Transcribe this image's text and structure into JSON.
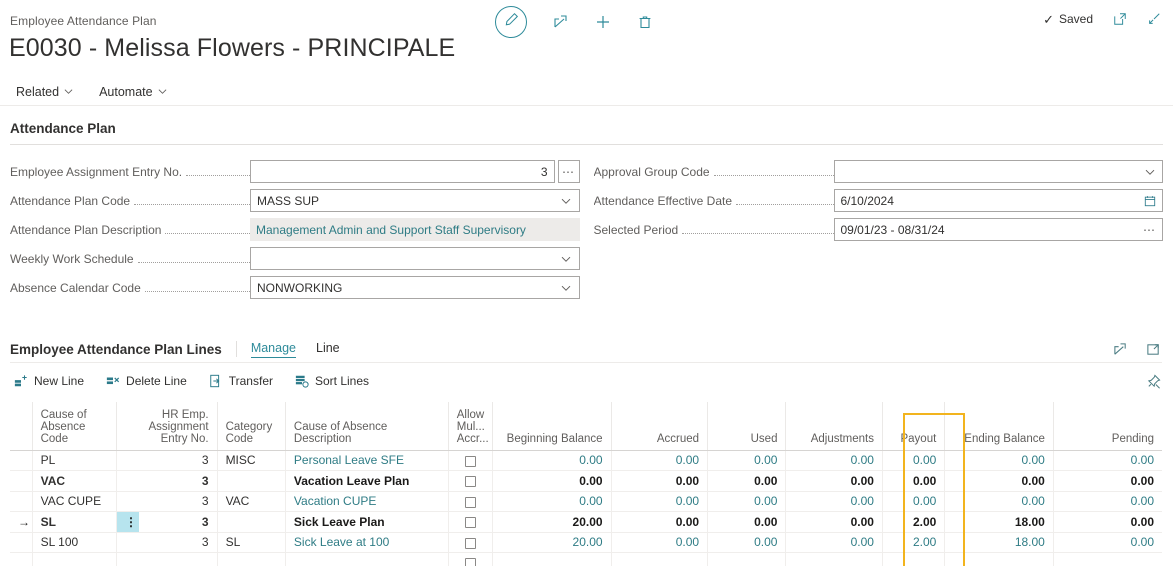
{
  "header": {
    "breadcrumb": "Employee Attendance Plan",
    "title": "E0030 - Melissa Flowers - PRINCIPALE",
    "saved_label": "Saved",
    "edit_icon": "pencil-icon",
    "share_icon": "share-icon",
    "new_icon": "plus-icon",
    "delete_icon": "trash-icon",
    "open_new_window_icon": "open-in-new-window-icon",
    "collapse_icon": "collapse-icon"
  },
  "menubar": {
    "items": [
      {
        "label": "Related",
        "icon": "chevron-down-icon"
      },
      {
        "label": "Automate",
        "icon": "chevron-down-icon"
      }
    ]
  },
  "fasttab": {
    "title": "Attendance Plan"
  },
  "form": {
    "left": [
      {
        "label": "Employee Assignment Entry No.",
        "value": "3",
        "align": "right",
        "type": "lookup",
        "icon": "ellipsis-button"
      },
      {
        "label": "Attendance Plan Code",
        "value": "MASS SUP",
        "align": "left",
        "type": "dropdown",
        "icon": "chevron-down-icon"
      },
      {
        "label": "Attendance Plan Description",
        "value": "Management Admin and Support Staff Supervisory",
        "align": "left",
        "type": "readonly",
        "icon": ""
      },
      {
        "label": "Weekly Work Schedule",
        "value": "",
        "align": "left",
        "type": "dropdown",
        "icon": "chevron-down-icon"
      },
      {
        "label": "Absence Calendar Code",
        "value": "NONWORKING",
        "align": "left",
        "type": "dropdown",
        "icon": "chevron-down-icon"
      }
    ],
    "right": [
      {
        "label": "Approval Group Code",
        "value": "",
        "align": "left",
        "type": "dropdown",
        "icon": "chevron-down-icon"
      },
      {
        "label": "Attendance Effective Date",
        "value": "6/10/2024",
        "align": "left",
        "type": "date",
        "icon": "calendar-icon"
      },
      {
        "label": "Selected Period",
        "value": "09/01/23 - 08/31/24",
        "align": "left",
        "type": "assist",
        "icon": "ellipsis-icon"
      }
    ]
  },
  "lines": {
    "title": "Employee Attendance Plan Lines",
    "tabs": [
      {
        "label": "Manage",
        "active": true
      },
      {
        "label": "Line",
        "active": false
      }
    ],
    "head_icons": [
      "share-icon",
      "expand-icon"
    ],
    "toolbar": [
      {
        "label": "New Line",
        "icon": "new-line-icon"
      },
      {
        "label": "Delete Line",
        "icon": "delete-line-icon"
      },
      {
        "label": "Transfer",
        "icon": "transfer-icon"
      },
      {
        "label": "Sort Lines",
        "icon": "sort-lines-icon"
      }
    ],
    "toolbar_right_icon": "unpin-icon",
    "columns": [
      {
        "key": "indicator",
        "label": "",
        "align": "c"
      },
      {
        "key": "cause_code",
        "label": "Cause of\nAbsence Code",
        "align": "l"
      },
      {
        "key": "menu",
        "label": "",
        "align": "c"
      },
      {
        "key": "entry_no",
        "label": "HR Emp.\nAssignment\nEntry No.",
        "align": "r"
      },
      {
        "key": "category",
        "label": "Category Code",
        "align": "l"
      },
      {
        "key": "description",
        "label": "Cause of Absence Description",
        "align": "l"
      },
      {
        "key": "allow_multi",
        "label": "Allow\nMul...\nAccr...",
        "align": "c"
      },
      {
        "key": "beginning",
        "label": "Beginning Balance",
        "align": "r"
      },
      {
        "key": "accrued",
        "label": "Accrued",
        "align": "r"
      },
      {
        "key": "used",
        "label": "Used",
        "align": "r"
      },
      {
        "key": "adjustments",
        "label": "Adjustments",
        "align": "r"
      },
      {
        "key": "payout",
        "label": "Payout",
        "align": "r",
        "highlight": true
      },
      {
        "key": "ending",
        "label": "Ending Balance",
        "align": "r"
      },
      {
        "key": "pending",
        "label": "Pending",
        "align": "r"
      }
    ],
    "highlight_color": "#f2b41e",
    "selection_color": "#b7e4ee",
    "rows": [
      {
        "selected": false,
        "bold": false,
        "cause_code": "PL",
        "entry_no": "3",
        "category": "MISC",
        "description": "Personal Leave SFE",
        "allow_multi": false,
        "beginning": "0.00",
        "accrued": "0.00",
        "used": "0.00",
        "adjustments": "0.00",
        "payout": "0.00",
        "ending": "0.00",
        "pending": "0.00"
      },
      {
        "selected": false,
        "bold": true,
        "cause_code": "VAC",
        "entry_no": "3",
        "category": "",
        "description": "Vacation Leave Plan",
        "allow_multi": false,
        "beginning": "0.00",
        "accrued": "0.00",
        "used": "0.00",
        "adjustments": "0.00",
        "payout": "0.00",
        "ending": "0.00",
        "pending": "0.00"
      },
      {
        "selected": false,
        "bold": false,
        "cause_code": "VAC CUPE",
        "entry_no": "3",
        "category": "VAC",
        "description": "Vacation CUPE",
        "allow_multi": false,
        "beginning": "0.00",
        "accrued": "0.00",
        "used": "0.00",
        "adjustments": "0.00",
        "payout": "0.00",
        "ending": "0.00",
        "pending": "0.00"
      },
      {
        "selected": true,
        "bold": true,
        "cause_code": "SL",
        "entry_no": "3",
        "category": "",
        "description": "Sick Leave Plan",
        "allow_multi": false,
        "beginning": "20.00",
        "accrued": "0.00",
        "used": "0.00",
        "adjustments": "0.00",
        "payout": "2.00",
        "ending": "18.00",
        "pending": "0.00"
      },
      {
        "selected": false,
        "bold": false,
        "cause_code": "SL 100",
        "entry_no": "3",
        "category": "SL",
        "description": "Sick Leave at 100",
        "allow_multi": false,
        "beginning": "20.00",
        "accrued": "0.00",
        "used": "0.00",
        "adjustments": "0.00",
        "payout": "2.00",
        "ending": "18.00",
        "pending": "0.00"
      },
      {
        "selected": false,
        "bold": false,
        "cause_code": "",
        "entry_no": "",
        "category": "",
        "description": "",
        "allow_multi": false,
        "beginning": "",
        "accrued": "",
        "used": "",
        "adjustments": "",
        "payout": "",
        "ending": "",
        "pending": ""
      }
    ]
  }
}
